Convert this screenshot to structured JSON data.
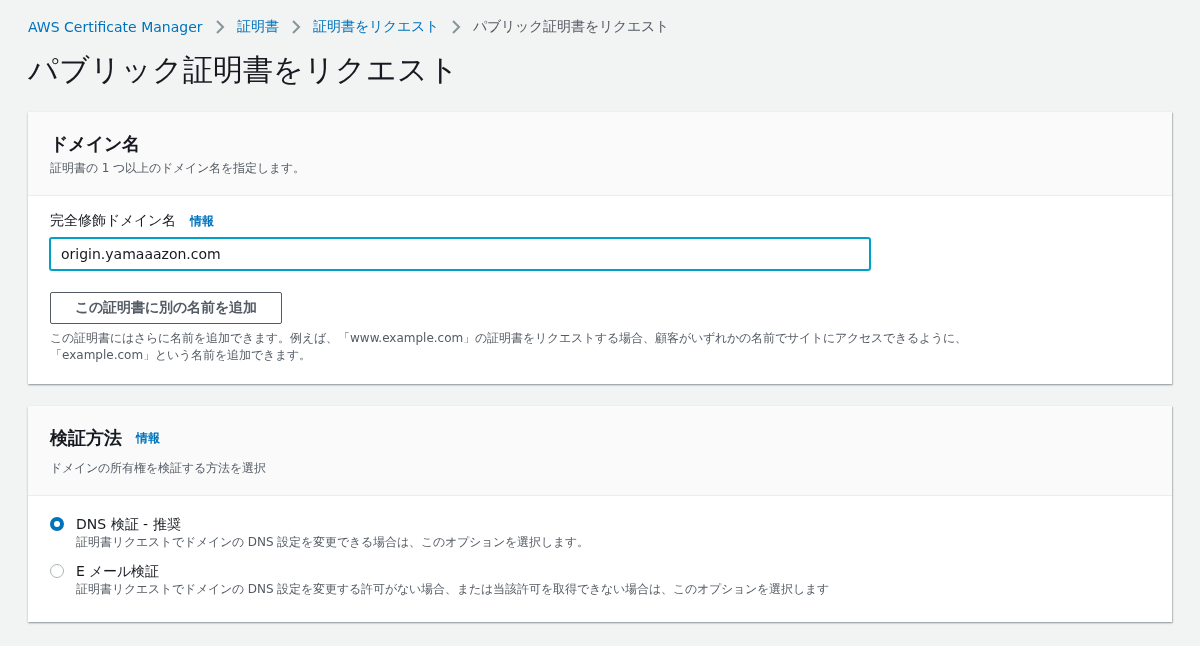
{
  "breadcrumb": [
    {
      "label": "AWS Certificate Manager",
      "link": true
    },
    {
      "label": "証明書",
      "link": true
    },
    {
      "label": "証明書をリクエスト",
      "link": true
    },
    {
      "label": "パブリック証明書をリクエスト",
      "link": false
    }
  ],
  "page_title": "パブリック証明書をリクエスト",
  "domain_section": {
    "title": "ドメイン名",
    "description": "証明書の 1 つ以上のドメイン名を指定します。",
    "field_label": "完全修飾ドメイン名",
    "info_link": "情報",
    "field_value": "origin.yamaaazon.com",
    "add_button": "この証明書に別の名前を追加",
    "help_text": "この証明書にはさらに名前を追加できます。例えば、「www.example.com」の証明書をリクエストする場合、顧客がいずれかの名前でサイトにアクセスできるように、「example.com」という名前を追加できます。"
  },
  "validation_section": {
    "title": "検証方法",
    "info_link": "情報",
    "description": "ドメインの所有権を検証する方法を選択",
    "options": [
      {
        "label": "DNS 検証 - 推奨",
        "description": "証明書リクエストでドメインの DNS 設定を変更できる場合は、このオプションを選択します。",
        "selected": true
      },
      {
        "label": "E メール検証",
        "description": "証明書リクエストでドメインの DNS 設定を変更する許可がない場合、または当該許可を取得できない場合は、このオプションを選択します",
        "selected": false
      }
    ]
  }
}
